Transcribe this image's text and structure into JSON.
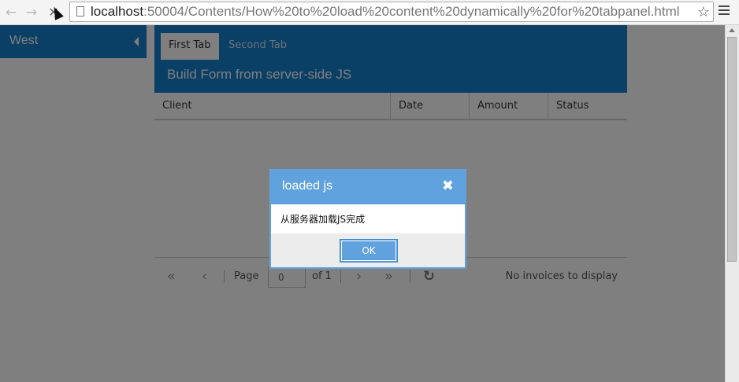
{
  "browser": {
    "url_host": "localhost",
    "url_rest": ":50004/Contents/How%20to%20load%20content%20dynamically%20for%20tabpanel.html",
    "back_icon": "←",
    "forward_icon": "→",
    "reload_icon": "✕",
    "star_icon": "☆"
  },
  "west": {
    "title": "West"
  },
  "tabs": [
    {
      "label": "First Tab",
      "active": true
    },
    {
      "label": "Second Tab",
      "active": false
    }
  ],
  "form": {
    "title": "Build Form from server-side JS"
  },
  "grid": {
    "columns": [
      "Client",
      "Date",
      "Amount",
      "Status"
    ]
  },
  "paging": {
    "first_icon": "«",
    "prev_icon": "‹",
    "page_label": "Page",
    "page_value": "0",
    "of_label": "of 1",
    "next_icon": "›",
    "last_icon": "»",
    "refresh_icon": "↻",
    "empty_message": "No invoices to display"
  },
  "messagebox": {
    "title": "loaded js",
    "close_icon": "✖",
    "message": "从服务器加载JS完成",
    "ok_label": "OK"
  },
  "colors": {
    "accent": "#157fcc",
    "dialog_accent": "#5fa2dd"
  }
}
